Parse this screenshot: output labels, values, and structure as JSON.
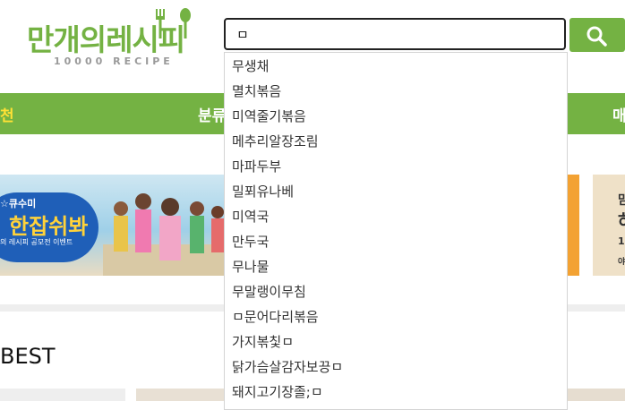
{
  "logo": {
    "title": "만개의레시피",
    "subtitle": "10000 RECIPE",
    "icon": "fork-spoon-icon"
  },
  "search": {
    "value": "ㅁ",
    "placeholder": "",
    "button_icon": "search-icon"
  },
  "nav": {
    "items": [
      {
        "label": "천"
      },
      {
        "label": "분류"
      },
      {
        "label": "매"
      }
    ]
  },
  "banner": {
    "line1": "☆큐수미",
    "big": "한잡쉬봐",
    "line3": "의 레시피 공모전 이벤트",
    "right_text_1": "맘",
    "right_text_2": "하",
    "right_text_3": "1",
    "right_text_4": "야"
  },
  "section": {
    "title": "BEST"
  },
  "suggestions": [
    "무생채",
    "멸치볶음",
    "미역줄기볶음",
    "메추리알장조림",
    "마파두부",
    "밀푀유나베",
    "미역국",
    "만두국",
    "무나물",
    "무말랭이무침",
    "ㅁ문어다리볶음",
    "가지볶칯ㅁ",
    "닭가슴살감자보끙ㅁ",
    "돼지고기장졸;ㅁ"
  ],
  "colors": {
    "brand_green": "#74b243",
    "nav_active": "#ffe135"
  }
}
